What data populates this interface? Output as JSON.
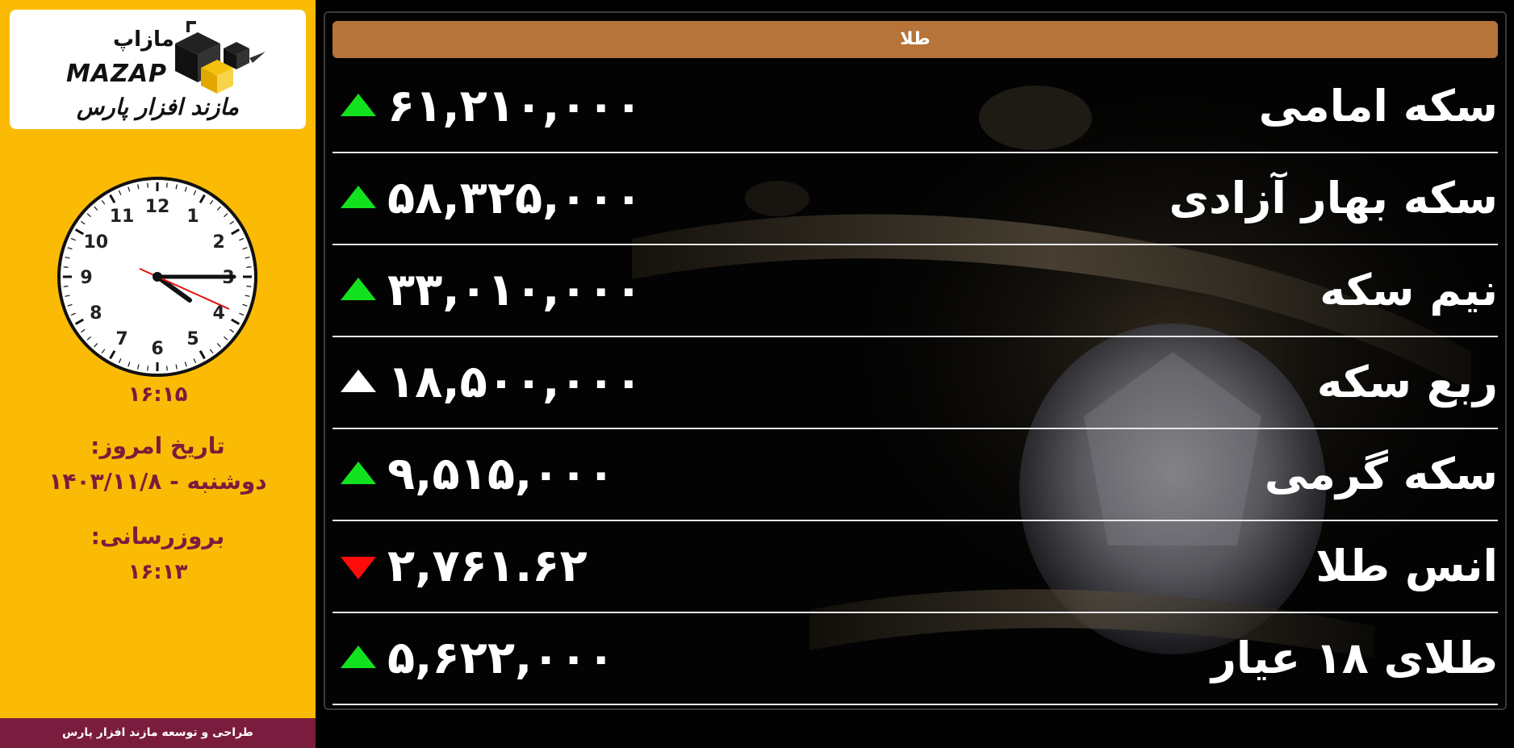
{
  "sidebar": {
    "logo": {
      "name_fa": "مازاپ",
      "name_en": "MAZAP",
      "tagline": "مازند افزار پارس"
    },
    "clock": {
      "numerals": [
        "12",
        "1",
        "2",
        "3",
        "4",
        "5",
        "6",
        "7",
        "8",
        "9",
        "10",
        "11"
      ],
      "time_text": "۱۶:۱۵"
    },
    "date_label": "تاریخ امروز:",
    "date_value": "دوشنبه - ۱۴۰۳/۱۱/۸",
    "update_label": "بروزرسانی:",
    "update_value": "۱۶:۱۳",
    "footer": "طراحی و توسعه مازند افزار پارس"
  },
  "main": {
    "header": "طلا",
    "rows": [
      {
        "name": "سکه امامی",
        "value": "۶۱,۲۱۰,۰۰۰",
        "trend": "up-green"
      },
      {
        "name": "سکه بهار آزادی",
        "value": "۵۸,۳۲۵,۰۰۰",
        "trend": "up-green"
      },
      {
        "name": "نیم سکه",
        "value": "۳۳,۰۱۰,۰۰۰",
        "trend": "up-green"
      },
      {
        "name": "ربع سکه",
        "value": "۱۸,۵۰۰,۰۰۰",
        "trend": "up-white"
      },
      {
        "name": "سکه گرمی",
        "value": "۹,۵۱۵,۰۰۰",
        "trend": "up-green"
      },
      {
        "name": "انس طلا",
        "value": "۲,۷۶۱.۶۲",
        "trend": "down-red"
      },
      {
        "name": "طلای ۱۸ عیار",
        "value": "۵,۶۲۲,۰۰۰",
        "trend": "up-green"
      }
    ]
  },
  "colors": {
    "sidebar_bg": "#fbbb05",
    "accent_text": "#7a1c3d",
    "header_bg": "#b6743a",
    "up": "#12e21e",
    "down": "#ff0b0b"
  }
}
